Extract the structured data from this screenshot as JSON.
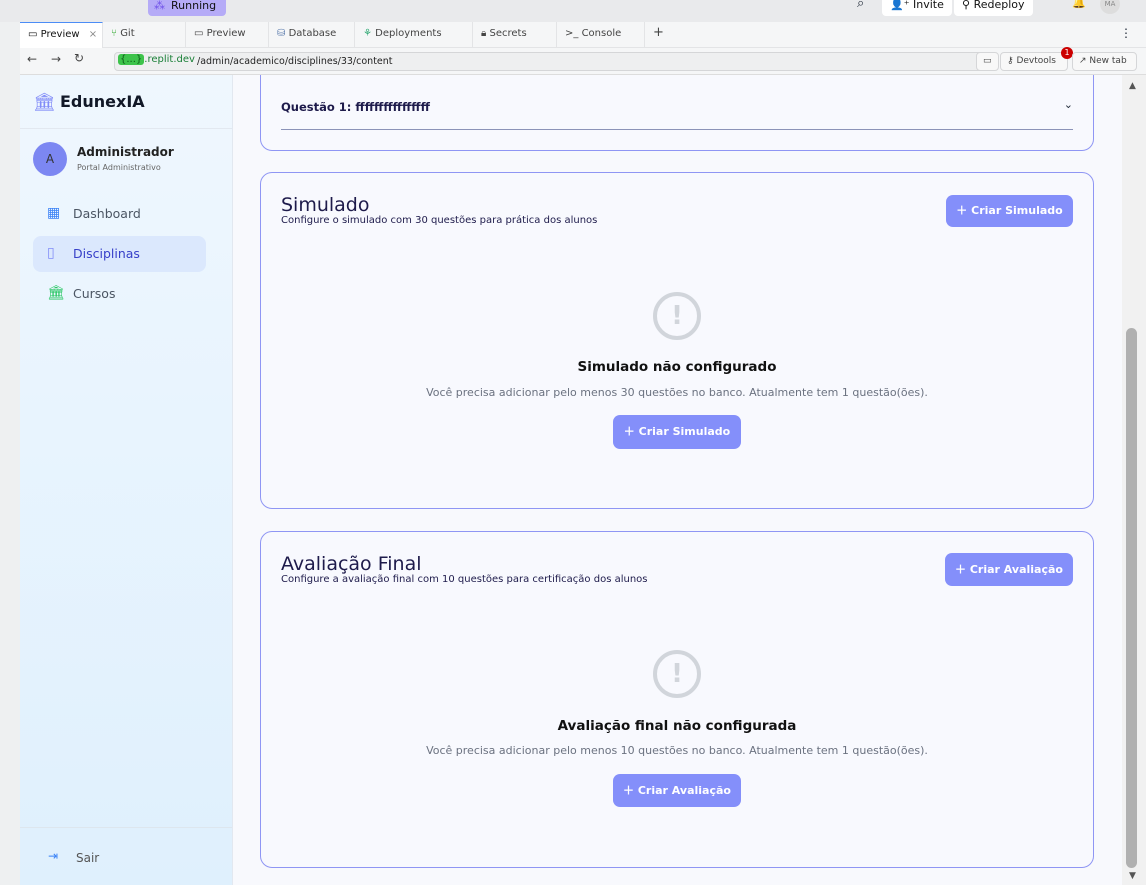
{
  "replit": {
    "status": "Running",
    "invite": "Invite",
    "redeploy": "Redeploy",
    "avatar": "MA",
    "tabs": [
      "Preview",
      "Git",
      "Preview",
      "Database",
      "Deployments",
      "Secrets",
      "Console"
    ],
    "host": "{...}",
    "host_suffix": ".replit.dev",
    "path": "/admin/academico/disciplines/33/content",
    "devtools": "Devtools",
    "devtools_badge": "1",
    "new_tab": "New tab"
  },
  "sidebar": {
    "brand": "EdunexIA",
    "user": {
      "initial": "A",
      "name": "Administrador",
      "role": "Portal Administrativo"
    },
    "items": [
      {
        "label": "Dashboard"
      },
      {
        "label": "Disciplinas"
      },
      {
        "label": "Cursos"
      }
    ],
    "logout": "Sair"
  },
  "question": {
    "label": "Questão 1: ffffffffffffffff"
  },
  "simulado": {
    "title": "Simulado",
    "subtitle": "Configure o simulado com 30 questões para prática dos alunos",
    "button": "Criar Simulado",
    "empty_title": "Simulado não configurado",
    "empty_text": "Você precisa adicionar pelo menos 30 questões no banco. Atualmente tem 1 questão(ões).",
    "empty_button": "Criar Simulado"
  },
  "avaliacao": {
    "title": "Avaliação Final",
    "subtitle": "Configure a avaliação final com 10 questões para certificação dos alunos",
    "button": "Criar Avaliação",
    "empty_title": "Avaliação final não configurada",
    "empty_text": "Você precisa adicionar pelo menos 10 questões no banco. Atualmente tem 1 questão(ões).",
    "empty_button": "Criar Avaliação"
  }
}
